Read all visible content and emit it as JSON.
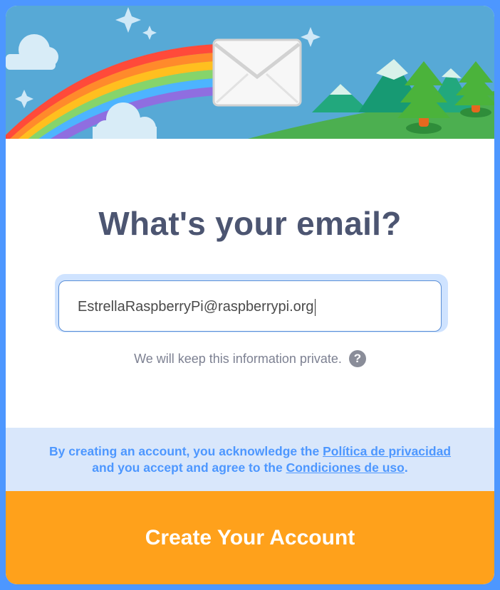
{
  "heading": "What's your email?",
  "email": {
    "value": "EstrellaRaspberryPi@raspberrypi.org"
  },
  "privacy": {
    "text": "We will keep this information private.",
    "help_icon": "question-mark-icon",
    "help_glyph": "?"
  },
  "legal": {
    "line1_prefix": "By creating an account, you acknowledge the ",
    "privacy_link": "Política de privacidad",
    "line2_prefix": "and you accept and agree to the ",
    "terms_link": "Condiciones de uso",
    "line2_suffix": "."
  },
  "create_button": "Create Your Account",
  "colors": {
    "accent_blue": "#4d97ff",
    "button_orange": "#ffa11b",
    "heading": "#4c5571",
    "legal_bg": "#d9e7fb"
  },
  "banner_icons": [
    "rainbow",
    "envelope-icon",
    "cloud",
    "sparkle",
    "mountains",
    "pine-tree"
  ]
}
